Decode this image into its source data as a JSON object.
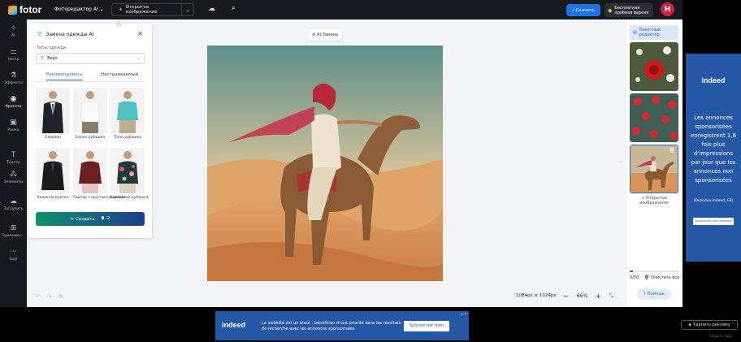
{
  "topbar": {
    "logo_text": "fotor",
    "editor_select": "Фоторедактор AI",
    "open_image": "Открытое изображение",
    "download": "Скачать",
    "trial_line1": "Бесплатная",
    "trial_line2": "пробная версия",
    "avatar_letter": "H"
  },
  "rail": [
    {
      "label": "AI",
      "icon": "ai-magic-icon"
    },
    {
      "label": "Настр",
      "icon": "adjust-icon"
    },
    {
      "label": "Эффекты",
      "icon": "effects-icon"
    },
    {
      "label": "Красота",
      "icon": "beauty-icon"
    },
    {
      "label": "Рамка",
      "icon": "frame-icon"
    },
    {
      "label": "Тексты",
      "icon": "text-icon"
    },
    {
      "label": "Элементы",
      "icon": "elements-icon"
    },
    {
      "label": "Загрузить",
      "icon": "upload-icon"
    },
    {
      "label": "Приложен...",
      "icon": "apps-icon"
    },
    {
      "label": "Ещё",
      "icon": "more-icon"
    }
  ],
  "panel": {
    "handle": "1/3",
    "title": "Замена одежды AI",
    "field_label": "Типы одежды",
    "dropdown_value": "Верх",
    "tab_recommended": "Рекомендовать",
    "tab_custom": "Настраиваемый",
    "items": [
      {
        "label": "Блейзер"
      },
      {
        "label": "Белая рубашка"
      },
      {
        "label": "Поло рубашка"
      },
      {
        "label": "Кожаная куртка"
      },
      {
        "label": "Свитер с круглым вырезом"
      },
      {
        "label": "Гавайская рубашка"
      }
    ],
    "create_label": "Создать",
    "credits": "-2"
  },
  "canvas": {
    "ai_chip": "AI Замена",
    "size": "1024px × 1024px",
    "zoom": "66%"
  },
  "right_panel": {
    "batch_line1": "Пакетный",
    "batch_line2": "редактор",
    "open_line1": "Открытое",
    "open_line2": "изображение",
    "count": "3/50",
    "progress": 0.06,
    "clear": "Очистить все",
    "help": "Помощь"
  },
  "ad_right": {
    "brand": "indeed",
    "message": "Les annonces sponsorisées enregistrent 1,6 fois plus d'impressions par jour que les annonces non sponsorisées",
    "source": "(Données Indeed, FR)",
    "cta": "Sponsoriser mon annonce"
  },
  "ad_bottom": {
    "brand": "indeed",
    "message": "La visibilité est un atout : bénéficiez d'une priorité dans les résultats de recherche avec les annonces sponsorisées",
    "cta": "Sponsoriser mon annonce"
  },
  "remove_ad": "Удалить рекламу",
  "hide_ad": "Закрыть ноду",
  "colors": {
    "accent": "#1a73e8",
    "dark": "#17191e",
    "indeed": "#2557a7",
    "avatar": "#c8233f"
  }
}
